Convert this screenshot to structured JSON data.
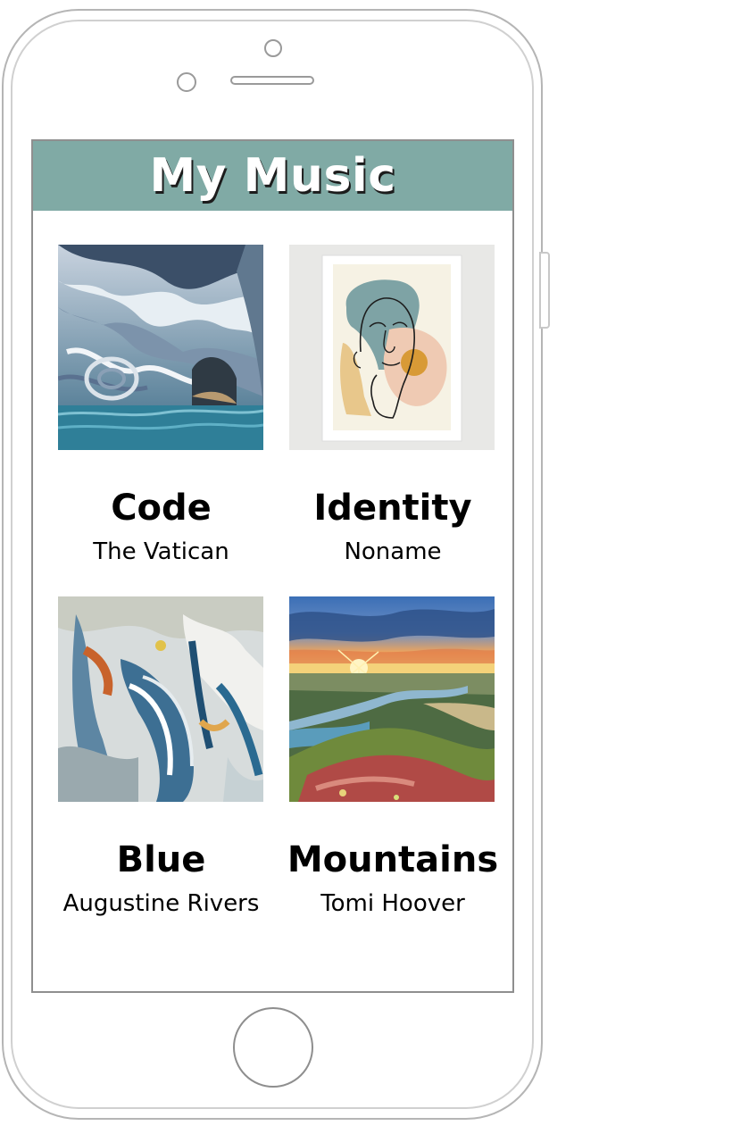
{
  "app": {
    "title": "My Music"
  },
  "colors": {
    "header": "#80aaa5",
    "header_text": "#ffffff"
  },
  "albums": [
    {
      "title": "Code",
      "artist": "The Vatican",
      "cover_icon": "marble-caves-image"
    },
    {
      "title": "Identity",
      "artist": "Noname",
      "cover_icon": "line-art-face-image"
    },
    {
      "title": "Blue",
      "artist": "Augustine Rivers",
      "cover_icon": "abstract-blue-painting-image"
    },
    {
      "title": "Mountains",
      "artist": "Tomi Hoover",
      "cover_icon": "sunset-valley-image"
    }
  ]
}
